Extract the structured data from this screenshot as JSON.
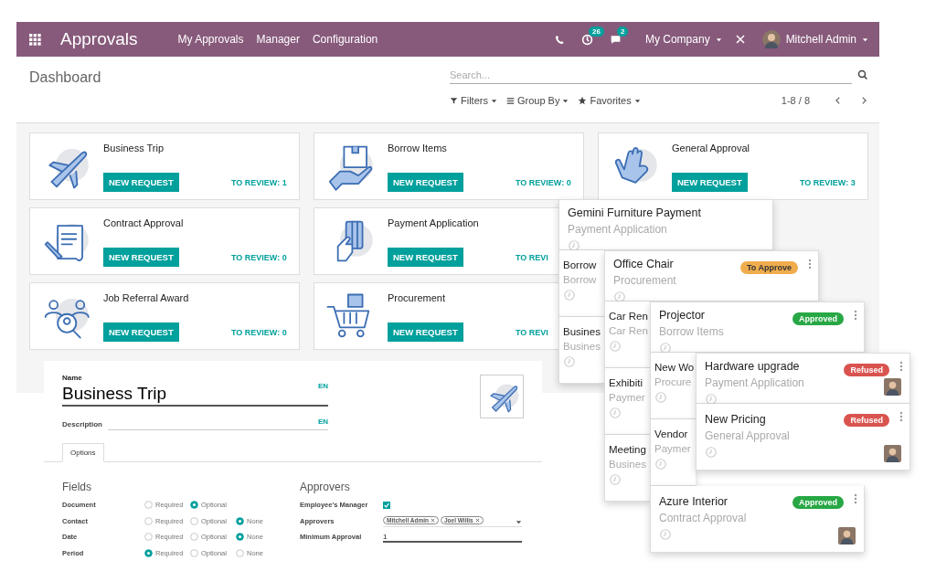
{
  "app": {
    "title": "Approvals",
    "menu": [
      "My Approvals",
      "Manager",
      "Configuration"
    ],
    "activity_count": "26",
    "message_count": "2",
    "company": "My Company",
    "user": "Mitchell Admin"
  },
  "control_panel": {
    "breadcrumb": "Dashboard",
    "search": {
      "placeholder": "Search..."
    },
    "filters": [
      "Filters",
      "Group By",
      "Favorites"
    ],
    "pager": "1-8 / 8"
  },
  "categories": [
    {
      "name": "Business Trip",
      "button": "NEW REQUEST",
      "review": "TO REVIEW: 1"
    },
    {
      "name": "Borrow Items",
      "button": "NEW REQUEST",
      "review": "TO REVIEW: 0"
    },
    {
      "name": "General Approval",
      "button": "NEW REQUEST",
      "review": "TO REVIEW: 3"
    },
    {
      "name": "Contract Approval",
      "button": "NEW REQUEST",
      "review": "TO REVIEW: 0"
    },
    {
      "name": "Payment Application",
      "button": "NEW REQUEST",
      "review": "TO REVI"
    },
    {
      "name": "Job Referral Award",
      "button": "NEW REQUEST",
      "review": "TO REVIEW: 0"
    },
    {
      "name": "Procurement",
      "button": "NEW REQUEST",
      "review": "TO REVI"
    }
  ],
  "form": {
    "name_label": "Name",
    "name_value": "Business Trip",
    "name_lang": "EN",
    "description_label": "Description",
    "description_lang": "EN",
    "tabs": [
      {
        "label": "Options",
        "selected": true
      }
    ],
    "fields": {
      "title": "Fields",
      "rows": [
        {
          "label": "Document",
          "options": [
            {
              "label": "Required",
              "selected": false
            },
            {
              "label": "Optional",
              "selected": true
            }
          ]
        },
        {
          "label": "Contact",
          "options": [
            {
              "label": "Required",
              "selected": false
            },
            {
              "label": "Optional",
              "selected": false
            },
            {
              "label": "None",
              "selected": true
            }
          ]
        },
        {
          "label": "Date",
          "options": [
            {
              "label": "Required",
              "selected": false
            },
            {
              "label": "Optional",
              "selected": false
            },
            {
              "label": "None",
              "selected": true
            }
          ]
        },
        {
          "label": "Period",
          "options": [
            {
              "label": "Required",
              "selected": true
            },
            {
              "label": "Optional",
              "selected": false
            },
            {
              "label": "None",
              "selected": false
            }
          ]
        }
      ]
    },
    "approvers": {
      "title": "Approvers",
      "manager_label": "Employee's Manager",
      "manager_checked": true,
      "approvers_label": "Approvers",
      "tags": [
        "Mitchell Admin",
        "Joel Willis"
      ],
      "minimum_label": "Minimum Approval",
      "minimum_value": "1"
    }
  },
  "kanban_stacks": [
    [
      {
        "title": "Gemini Furniture Payment",
        "type": "Payment Application"
      },
      {
        "title": "Borrow",
        "type": "Borrow"
      },
      {
        "title": "Busines",
        "type": "Busines"
      }
    ],
    [
      {
        "title": "Office Chair",
        "type": "Procurement",
        "status": {
          "label": "To Approve",
          "kind": "to_approve"
        }
      },
      {
        "title": "Car Ren",
        "type": "Car Ren"
      },
      {
        "title": "Exhibiti",
        "type": "Paymer"
      },
      {
        "title": "Meeting",
        "type": "Busines"
      }
    ],
    [
      {
        "title": "Projector",
        "type": "Borrow Items",
        "status": {
          "label": "Approved",
          "kind": "approved"
        }
      },
      {
        "title": "New Wo",
        "type": "Procure"
      },
      {
        "title": "Vendor",
        "type": "Paymer"
      },
      {
        "title": "Azure Interior",
        "type": "Contract Approval",
        "status": {
          "label": "Approved",
          "kind": "approved"
        },
        "avatar": true
      }
    ],
    [
      {
        "title": "Hardware upgrade",
        "type": "Payment Application",
        "status": {
          "label": "Refused",
          "kind": "refused"
        },
        "avatar": true
      },
      {
        "title": "New Pricing",
        "type": "General Approval",
        "status": {
          "label": "Refused",
          "kind": "refused"
        },
        "avatar": true
      }
    ]
  ]
}
